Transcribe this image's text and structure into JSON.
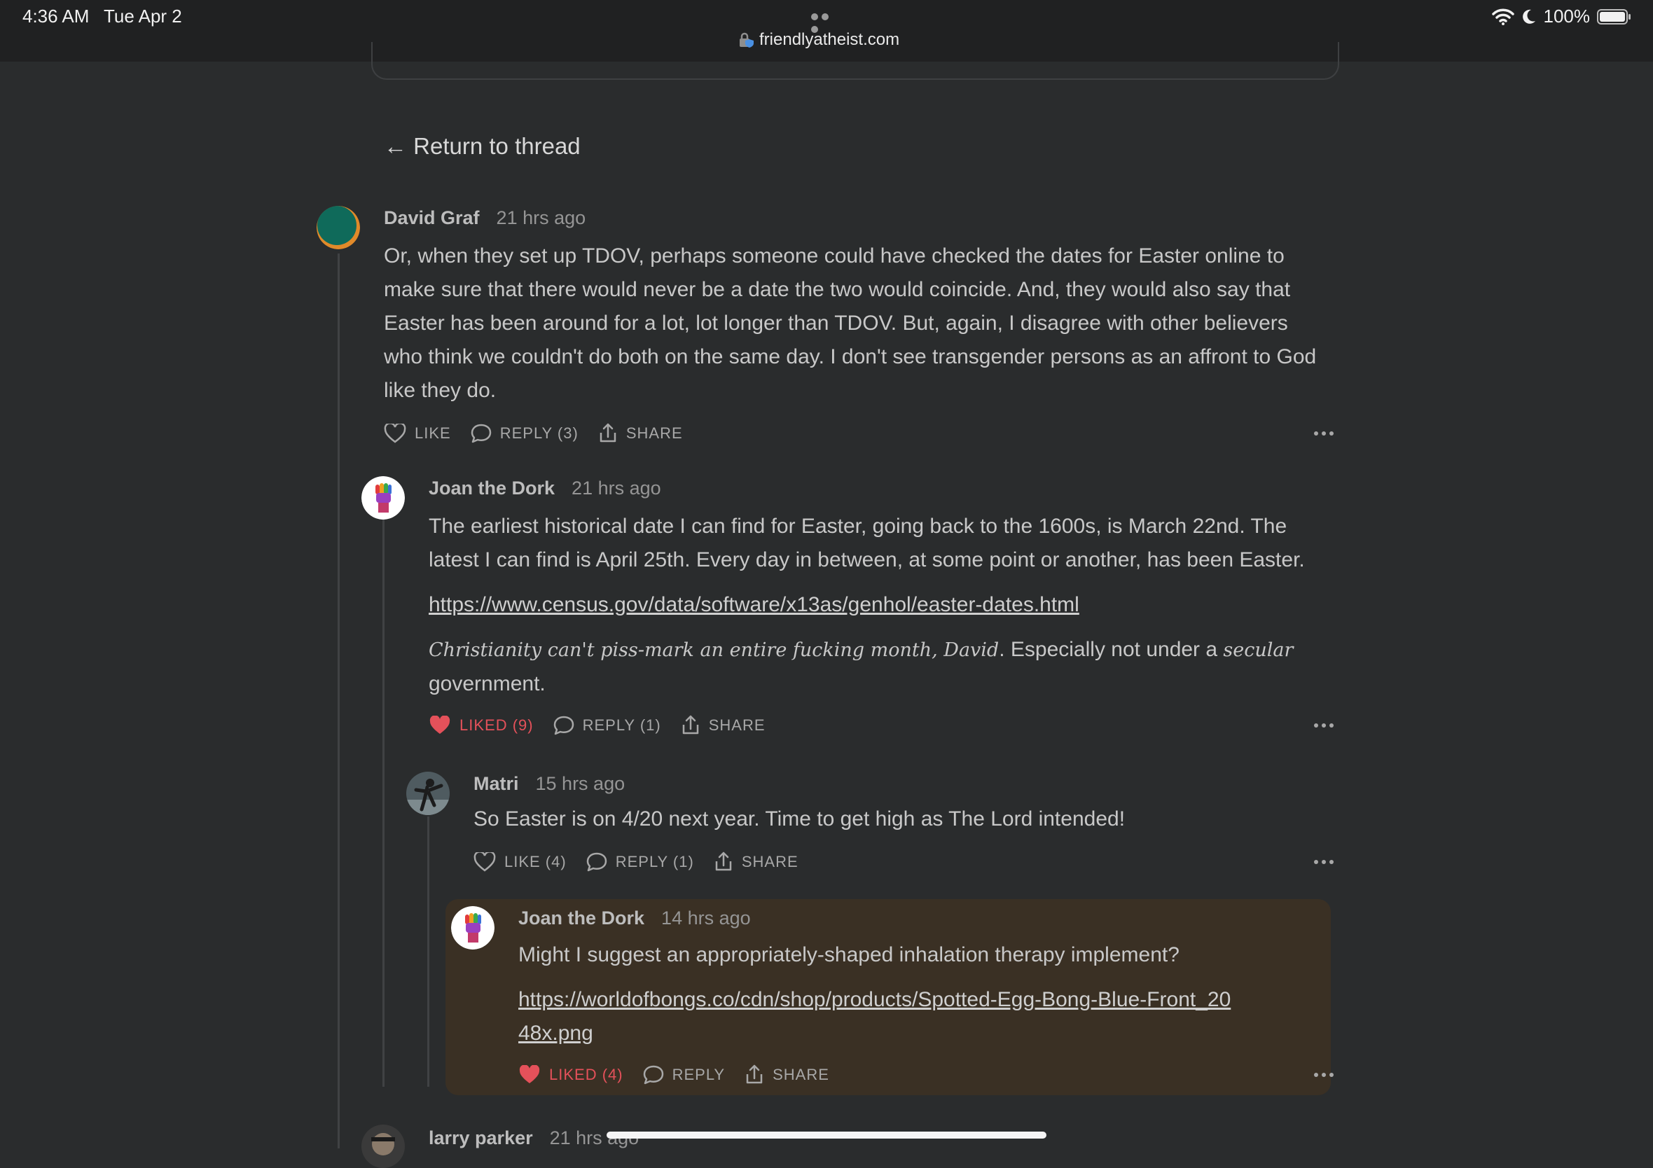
{
  "status_bar": {
    "time": "4:36 AM",
    "date": "Tue Apr 2",
    "url": "friendlyatheist.com",
    "battery": "100%"
  },
  "return_link": "← Return to thread",
  "comments": [
    {
      "author": "David Graf",
      "time": "21 hrs ago",
      "text": "Or, when they set up TDOV, perhaps someone could have checked the dates for Easter online to make sure that there would never be a date the two would coincide. And, they would also say that Easter has been around for a lot, lot longer than TDOV. But, again, I disagree with other believers who think we couldn't do both on the same day. I don't see transgender persons as an affront to God like they do.",
      "like": "LIKE",
      "reply": "REPLY (3)",
      "share": "SHARE"
    },
    {
      "author": "Joan the Dork",
      "time": "21 hrs ago",
      "text": "The earliest historical date I can find for Easter, going back to the 1600s, is March 22nd. The latest I can find is April 25th. Every day in between, at some point or another, has been Easter.",
      "link": "https://www.census.gov/data/software/x13as/genhol/easter-dates.html",
      "italic_part": "Christianity can't piss-mark an entire fucking month, David",
      "normal_part": ". Especially not under a ",
      "italic_word": "secular",
      "tail": " government.",
      "like": "LIKED (9)",
      "reply": "REPLY (1)",
      "share": "SHARE"
    },
    {
      "author": "Matri",
      "time": "15 hrs ago",
      "text": "So Easter is on 4/20 next year. Time to get high as The Lord intended!",
      "like": "LIKE (4)",
      "reply": "REPLY (1)",
      "share": "SHARE"
    },
    {
      "author": "Joan the Dork",
      "time": "14 hrs ago",
      "text": "Might I suggest an appropriately-shaped inhalation therapy implement?",
      "link": "https://worldofbongs.co/cdn/shop/products/Spotted-Egg-Bong-Blue-Front_2048x.png",
      "like": "LIKED (4)",
      "reply": "REPLY",
      "share": "SHARE"
    },
    {
      "author": "larry parker",
      "time": "21 hrs ago"
    }
  ],
  "colors": {
    "background": "#2a2c2d",
    "liked": "#e4515a",
    "highlight": "#3a3024"
  }
}
